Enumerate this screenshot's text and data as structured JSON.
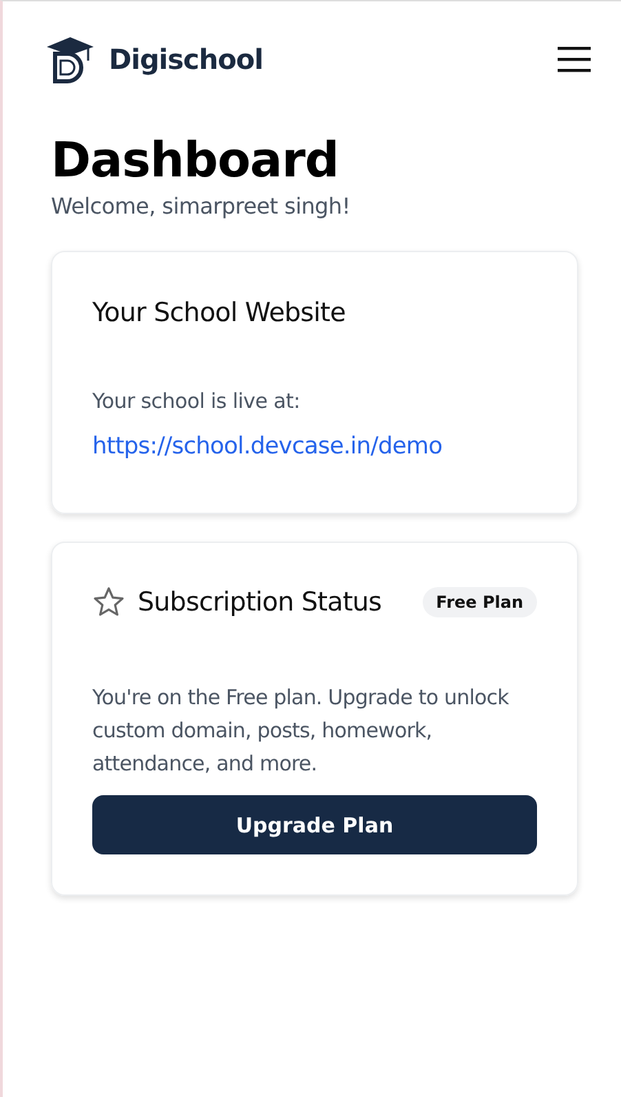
{
  "header": {
    "brand": "Digischool"
  },
  "page": {
    "title": "Dashboard",
    "welcome": "Welcome, simarpreet singh!"
  },
  "website_card": {
    "title": "Your School Website",
    "label": "Your school is live at:",
    "link": "https://school.devcase.in/demo"
  },
  "subscription_card": {
    "title": "Subscription Status",
    "badge": "Free Plan",
    "description": "You're on the Free plan. Upgrade to unlock custom domain, posts, homework, attendance, and more.",
    "button": "Upgrade Plan"
  }
}
